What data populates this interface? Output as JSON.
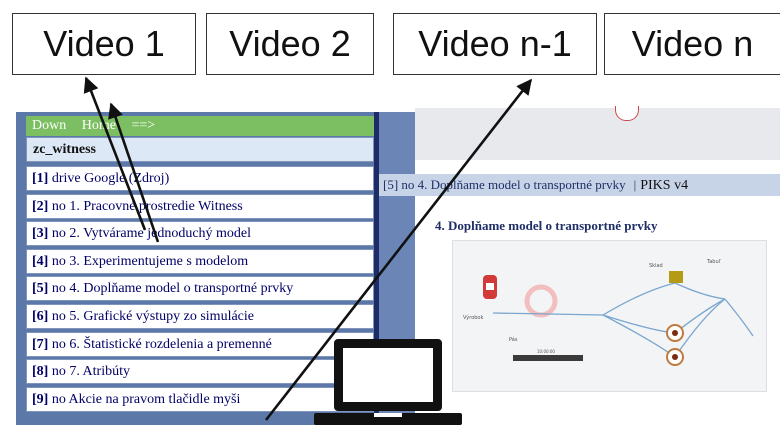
{
  "videos": [
    "Video 1",
    "Video 2",
    "Video n-1",
    "Video n"
  ],
  "left_panel": {
    "nav": [
      "Down",
      "Home",
      "==>"
    ],
    "subtitle": "zc_witness",
    "items": [
      {
        "num": "[1]",
        "text": "drive Google (Zdroj)"
      },
      {
        "num": "[2]",
        "text": "no 1. Pracovné prostredie Witness"
      },
      {
        "num": "[3]",
        "text": "no 2. Vytvárame jednoduchý model"
      },
      {
        "num": "[4]",
        "text": "no 3. Experimentujeme s modelom"
      },
      {
        "num": "[5]",
        "text": "no 4. Doplňame model o transportné prvky"
      },
      {
        "num": "[6]",
        "text": "no 5. Grafické výstupy zo simulácie"
      },
      {
        "num": "[7]",
        "text": "no 6. Štatistické rozdelenia a premenné"
      },
      {
        "num": "[8]",
        "text": "no 7. Atribúty"
      },
      {
        "num": "[9]",
        "text": "no Akcie na pravom tlačidle myši"
      }
    ]
  },
  "right_panel": {
    "breadcrumb": "[5] no 4. Doplňame model o transportné prvky",
    "separator": "|",
    "site": "PIKS v4",
    "title": "4. Doplňame model o transportné prvky",
    "model_labels": [
      "Výrobok",
      "Sklad",
      "Pás",
      "10:00:00",
      "Tabuľ"
    ]
  },
  "colors": {
    "nav_green": "#7cbf62",
    "panel_blue": "#5b78a8",
    "arrow": "#111111",
    "entity_red": "#d23a3a"
  }
}
